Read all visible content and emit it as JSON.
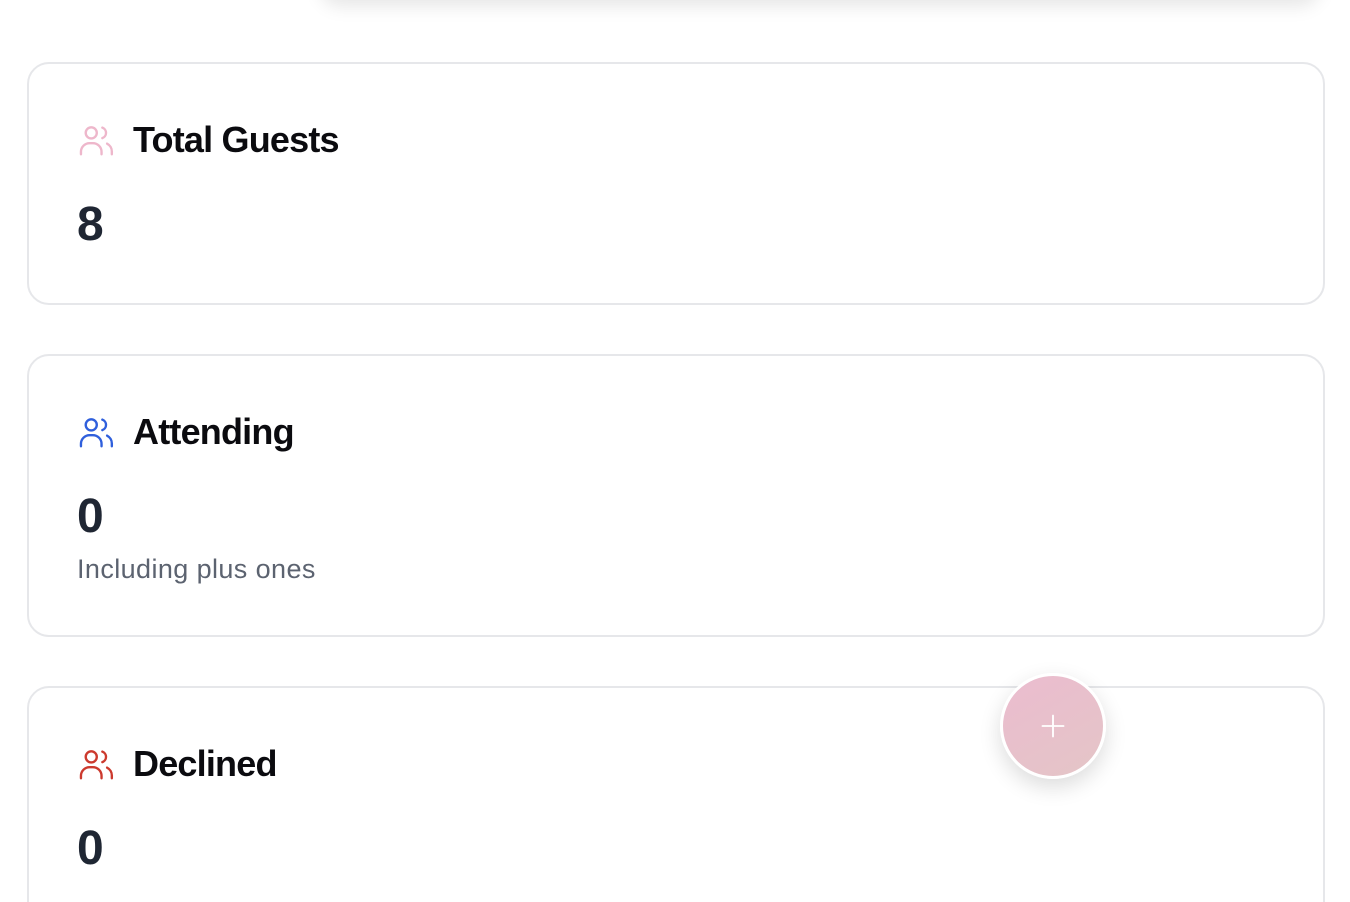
{
  "stats": [
    {
      "title": "Total Guests",
      "value": "8",
      "subtitle": "",
      "icon": "users-icon",
      "icon_color": "#eeb7cb"
    },
    {
      "title": "Attending",
      "value": "0",
      "subtitle": "Including plus ones",
      "icon": "users-icon",
      "icon_color": "#2f5fdc"
    },
    {
      "title": "Declined",
      "value": "0",
      "subtitle": "",
      "icon": "users-icon",
      "icon_color": "#cc3a2e"
    }
  ],
  "fab": {
    "icon": "plus-icon",
    "color": "#e9bfcc"
  }
}
